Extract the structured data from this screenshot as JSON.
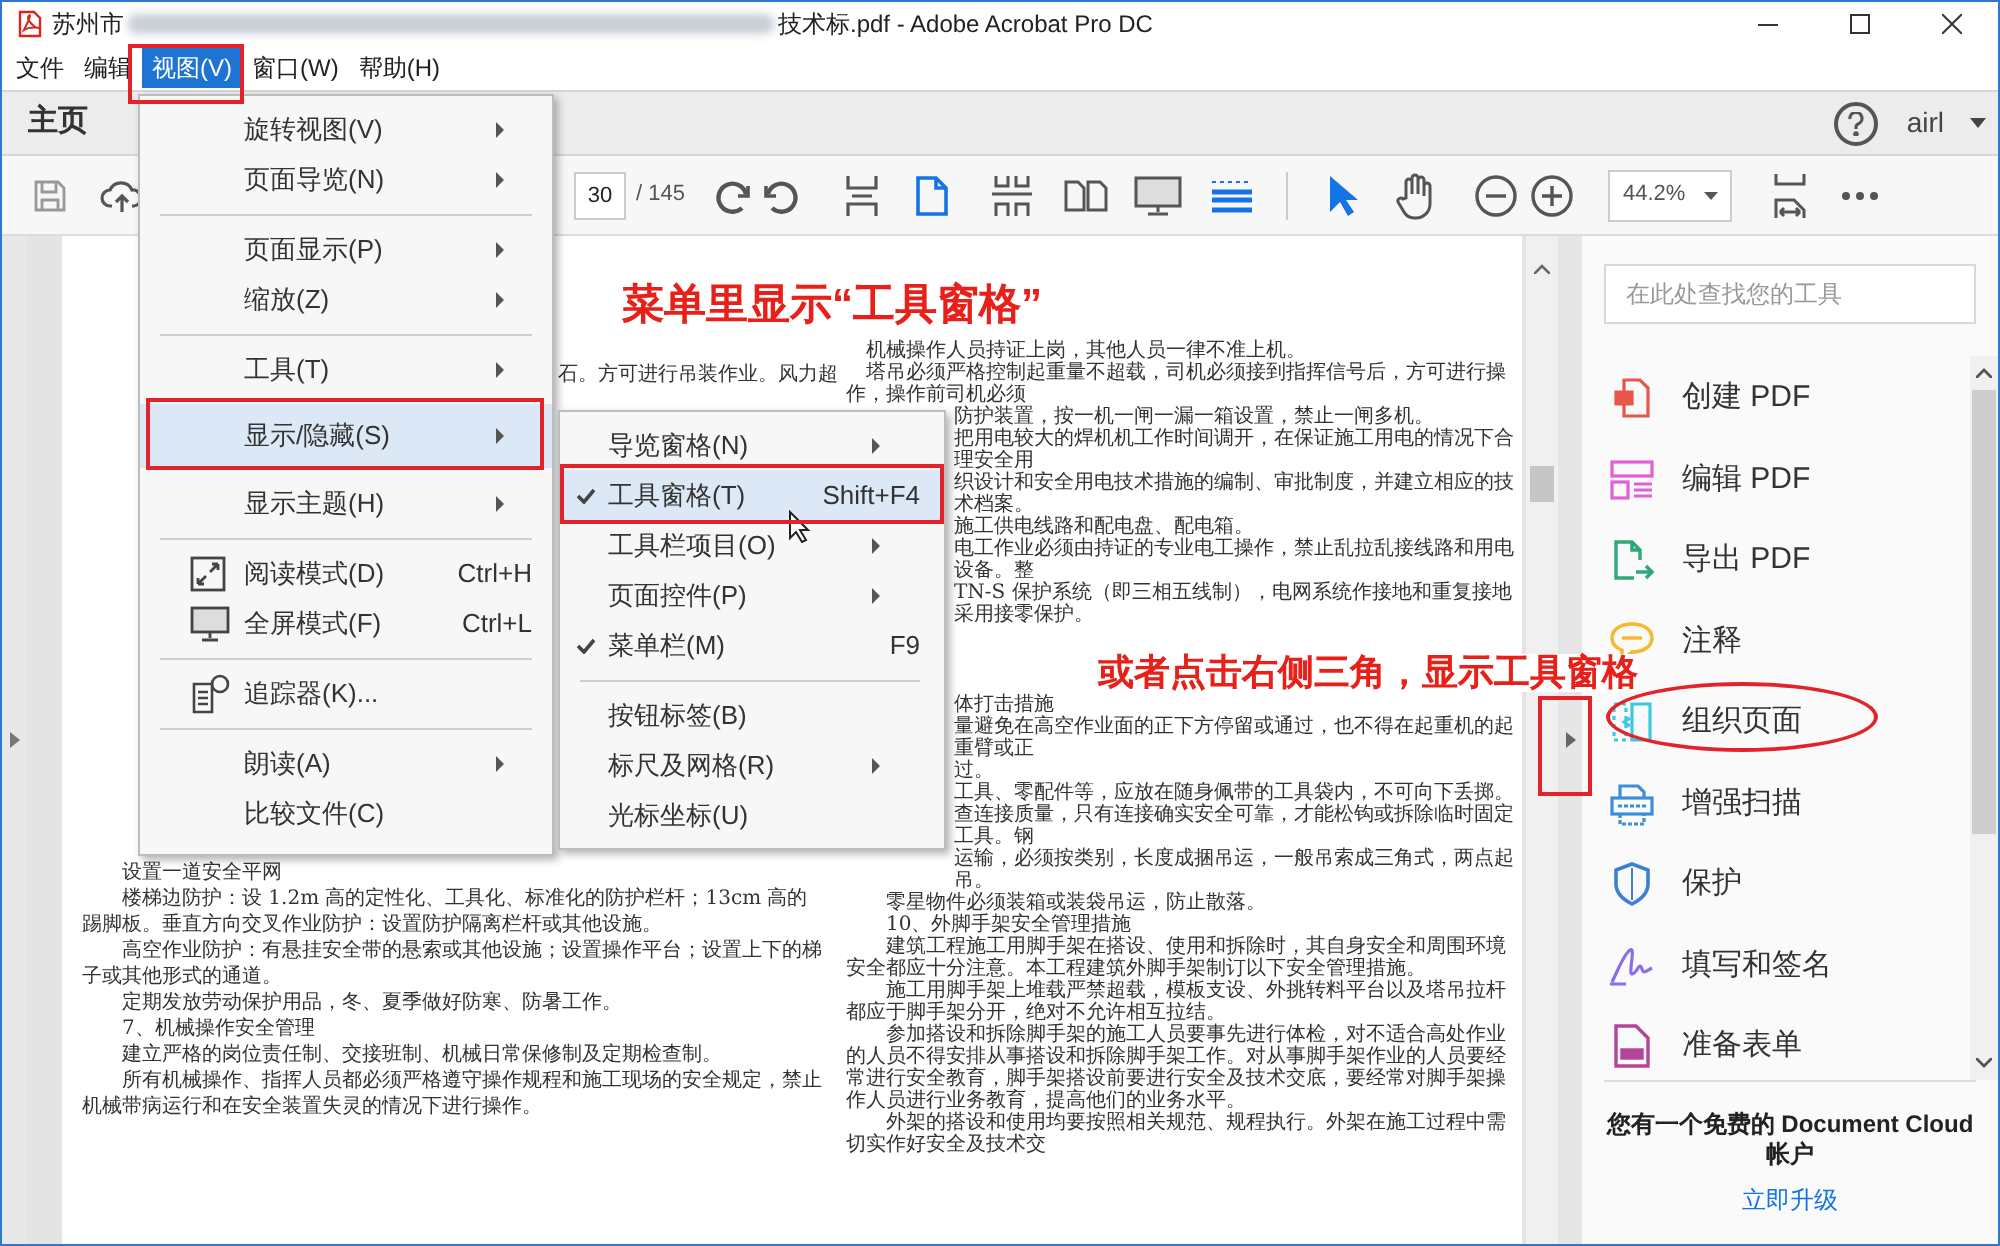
{
  "window": {
    "title_start": "苏州市",
    "title_end": "技术标.pdf - Adobe Acrobat Pro DC"
  },
  "menu_bar": [
    {
      "label": "文件",
      "selected": false
    },
    {
      "label": "编辑",
      "selected": false
    },
    {
      "label": "视图(V)",
      "selected": true
    },
    {
      "label": "窗口(W)",
      "selected": false
    },
    {
      "label": "帮助(H)",
      "selected": false
    }
  ],
  "tab_bar": {
    "tab": "主页",
    "user": "airl"
  },
  "toolbar": {
    "page_number": "30",
    "page_count": "/ 145",
    "zoom": "44.2%"
  },
  "view_menu": {
    "items": [
      {
        "kind": "item",
        "label": "旋转视图(V)",
        "submenu": true,
        "selected": false
      },
      {
        "kind": "item",
        "label": "页面导览(N)",
        "submenu": true,
        "selected": false
      },
      {
        "kind": "separator"
      },
      {
        "kind": "item",
        "label": "页面显示(P)",
        "submenu": true,
        "selected": false
      },
      {
        "kind": "item",
        "label": "缩放(Z)",
        "submenu": true,
        "selected": false
      },
      {
        "kind": "separator"
      },
      {
        "kind": "item",
        "label": "工具(T)",
        "submenu": true,
        "selected": false
      },
      {
        "kind": "item",
        "label": "显示/隐藏(S)",
        "submenu": true,
        "selected": true
      },
      {
        "kind": "item",
        "label": "显示主题(H)",
        "submenu": true,
        "selected": false
      },
      {
        "kind": "separator"
      },
      {
        "kind": "item",
        "label": "阅读模式(D)",
        "shortcut": "Ctrl+H",
        "submenu": false,
        "selected": false
      },
      {
        "kind": "item",
        "label": "全屏模式(F)",
        "shortcut": "Ctrl+L",
        "submenu": false,
        "selected": false
      },
      {
        "kind": "separator"
      },
      {
        "kind": "item",
        "label": "追踪器(K)...",
        "submenu": false,
        "selected": false
      },
      {
        "kind": "separator"
      },
      {
        "kind": "item",
        "label": "朗读(A)",
        "submenu": true,
        "selected": false
      },
      {
        "kind": "item",
        "label": "比较文件(C)",
        "submenu": false,
        "selected": false
      }
    ]
  },
  "show_hide_menu": {
    "items": [
      {
        "kind": "item",
        "label": "导览窗格(N)",
        "submenu": true,
        "checked": false,
        "selected": false
      },
      {
        "kind": "item",
        "label": "工具窗格(T)",
        "shortcut": "Shift+F4",
        "submenu": false,
        "checked": true,
        "selected": true
      },
      {
        "kind": "item",
        "label": "工具栏项目(O)",
        "submenu": true,
        "checked": false,
        "selected": false
      },
      {
        "kind": "item",
        "label": "页面控件(P)",
        "submenu": true,
        "checked": false,
        "selected": false
      },
      {
        "kind": "item",
        "label": "菜单栏(M)",
        "shortcut": "F9",
        "submenu": false,
        "checked": true,
        "selected": false
      },
      {
        "kind": "separator"
      },
      {
        "kind": "item",
        "label": "按钮标签(B)",
        "submenu": false,
        "checked": false,
        "selected": false
      },
      {
        "kind": "item",
        "label": "标尺及网格(R)",
        "submenu": true,
        "checked": false,
        "selected": false
      },
      {
        "kind": "item",
        "label": "光标坐标(U)",
        "submenu": false,
        "checked": false,
        "selected": false
      }
    ]
  },
  "document": {
    "left_fragment": "石。方可进行吊装作业。风力超",
    "left_paragraphs": [
      "设置一道安全平网",
      "楼梯边防护：设 1.2m 高的定性化、工具化、标准化的防护栏杆；13cm 高的踢脚板。垂直方向交叉作业防护：设置防护隔离栏杆或其他设施。",
      "高空作业防护：有悬挂安全带的悬索或其他设施；设置操作平台；设置上下的梯子或其他形式的通道。",
      "定期发放劳动保护用品，冬、夏季做好防寒、防暑工作。",
      "7、机械操作安全管理",
      "建立严格的岗位责任制、交接班制、机械日常保修制及定期检查制。",
      "所有机械操作、指挥人员都必须严格遵守操作规程和施工现场的安全规定，禁止机械带病运行和在安全装置失灵的情况下进行操作。"
    ],
    "right_top": [
      "机械操作人员持证上岗，其他人员一律不准上机。",
      "塔吊必须严格控制起重量不超载，司机必须接到指挥信号后，方可进行操作，操作前司机必须"
    ],
    "right_fragments_upper": [
      "防护装置，按一机一闸一漏一箱设置，禁止一闸多机。",
      "把用电较大的焊机机工作时间调开，在保证施工用电的情况下合理安全用",
      "织设计和安全用电技术措施的编制、审批制度，并建立相应的技术档案。",
      "施工供电线路和配电盘、配电箱。",
      "电工作业必须由持证的专业电工操作，禁止乱拉乱接线路和用电设备。整",
      "TN-S 保护系统（即三相五线制），电网系统作接地和重复接地",
      "采用接零保护。"
    ],
    "right_fragments_lower": [
      "体打击措施",
      "量避免在高空作业面的正下方停留或通过，也不得在起重机的起重臂或正",
      "过。",
      "工具、零配件等，应放在随身佩带的工具袋内，不可向下丢掷。",
      "查连接质量，只有连接确实安全可靠，才能松钩或拆除临时固定工具。钢",
      "运输，必须按类别，长度成捆吊运，一般吊索成三角式，两点起吊。"
    ],
    "right_paragraphs": [
      "零星物件必须装箱或装袋吊运，防止散落。",
      "10、外脚手架安全管理措施",
      "建筑工程施工用脚手架在搭设、使用和拆除时，其自身安全和周围环境安全都应十分注意。本工程建筑外脚手架制订以下安全管理措施。",
      "施工用脚手架上堆载严禁超载，模板支设、外挑转料平台以及塔吊拉杆都应于脚手架分开，绝对不允许相互拉结。",
      "参加搭设和拆除脚手架的施工人员要事先进行体检，对不适合高处作业的人员不得安排从事搭设和拆除脚手架工作。对从事脚手架作业的人员要经常进行安全教育，脚手架搭设前要进行安全及技术交底，要经常对脚手架操作人员进行业务教育，提高他们的业务水平。",
      "外架的搭设和使用均要按照相关规范、规程执行。外架在施工过程中需切实作好安全及技术交"
    ]
  },
  "annotations": [
    "菜单里显示“工具窗格”",
    "或者点击右侧三角，显示工具窗格"
  ],
  "tools_panel": {
    "search_placeholder": "在此处查找您的工具",
    "tools": [
      {
        "label": "创建 PDF",
        "color": "#e8574b"
      },
      {
        "label": "编辑 PDF",
        "color": "#e25fd6"
      },
      {
        "label": "导出 PDF",
        "color": "#2fa878"
      },
      {
        "label": "注释",
        "color": "#f5b82e"
      },
      {
        "label": "组织页面",
        "color": "#3ec7e0"
      },
      {
        "label": "增强扫描",
        "color": "#3a8fd8"
      },
      {
        "label": "保护",
        "color": "#3d7fd6"
      },
      {
        "label": "填写和签名",
        "color": "#8a6cf0"
      },
      {
        "label": "准备表单",
        "color": "#b4459a"
      }
    ],
    "account_note": "您有一个免费的 Document Cloud 帐户",
    "upgrade_link": "立即升级"
  }
}
